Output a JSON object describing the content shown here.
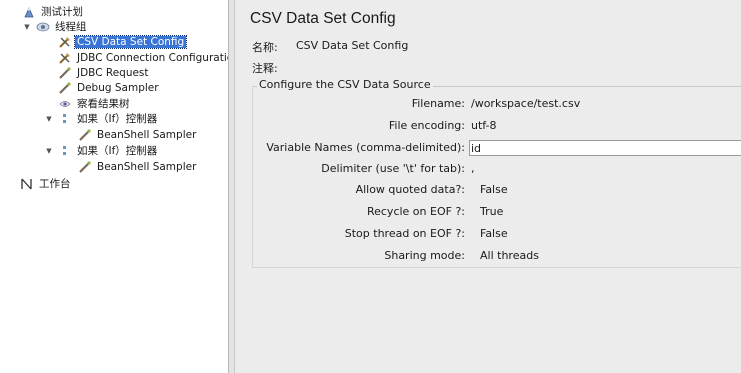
{
  "tree": {
    "items": [
      {
        "label": "测试计划",
        "level": 0,
        "expanded": true,
        "icon": "test-plan-icon"
      },
      {
        "label": "线程组",
        "level": 1,
        "expanded": true,
        "icon": "thread-group-icon"
      },
      {
        "label": "CSV Data Set Config",
        "level": 2,
        "selected": true,
        "icon": "config-element-icon"
      },
      {
        "label": "JDBC Connection Configuratic",
        "level": 2,
        "icon": "config-element-icon"
      },
      {
        "label": "JDBC Request",
        "level": 2,
        "icon": "sampler-icon"
      },
      {
        "label": "Debug Sampler",
        "level": 2,
        "icon": "sampler-icon"
      },
      {
        "label": "察看结果树",
        "level": 2,
        "icon": "listener-icon"
      },
      {
        "label": "如果（If）控制器",
        "level": 2,
        "expanded": true,
        "icon": "controller-icon"
      },
      {
        "label": "BeanShell Sampler",
        "level": 3,
        "icon": "sampler-icon"
      },
      {
        "label": "如果（If）控制器",
        "level": 2,
        "expanded": true,
        "icon": "controller-icon"
      },
      {
        "label": "BeanShell Sampler",
        "level": 3,
        "icon": "sampler-icon"
      },
      {
        "label": "工作台",
        "level": 0,
        "icon": "workbench-icon"
      }
    ]
  },
  "panel": {
    "title": "CSV Data Set Config",
    "name_label": "名称:",
    "name_value": "CSV Data Set Config",
    "comment_label": "注释:",
    "section_title": "Configure the CSV Data Source",
    "fields": [
      {
        "label": "Filename:",
        "value": "/workspace/test.csv",
        "kind": "text"
      },
      {
        "label": "File encoding:",
        "value": "utf-8",
        "kind": "text"
      },
      {
        "label": "Variable Names (comma-delimited):",
        "value": "id",
        "kind": "input"
      },
      {
        "label": "Delimiter (use '\\t' for tab):",
        "value": ",",
        "kind": "text"
      },
      {
        "label": "Allow quoted data?:",
        "value": "False",
        "kind": "select"
      },
      {
        "label": "Recycle on EOF ?:",
        "value": "True",
        "kind": "select"
      },
      {
        "label": "Stop thread on EOF ?:",
        "value": "False",
        "kind": "select"
      },
      {
        "label": "Sharing mode:",
        "value": "All threads",
        "kind": "select"
      }
    ]
  },
  "colors": {
    "selection": "#3875d7",
    "panel_bg": "#ececec",
    "tree_bg": "#ffffff"
  }
}
